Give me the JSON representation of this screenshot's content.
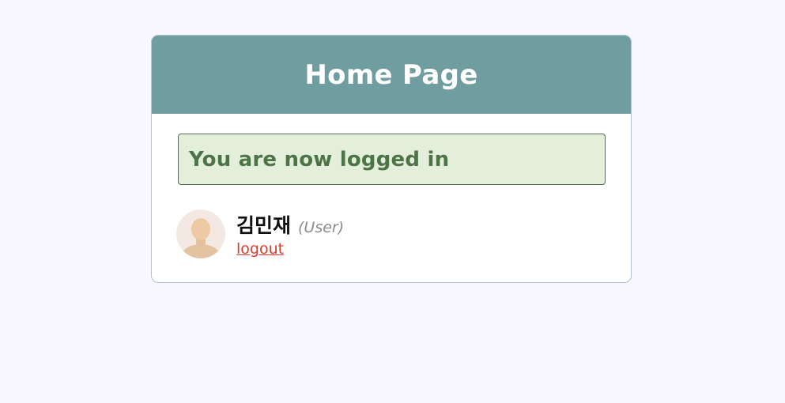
{
  "header": {
    "title": "Home Page"
  },
  "alert": {
    "message": "You are now logged in"
  },
  "user": {
    "name": "김민재",
    "role": "(User)",
    "logout_label": "logout",
    "avatar_icon": "user-avatar-icon"
  },
  "colors": {
    "page_background": "#f8f7fe",
    "header_background": "#709ea0",
    "success_background": "#e3efdb",
    "success_text": "#4d7446",
    "logout_link": "#dc3b2e"
  }
}
